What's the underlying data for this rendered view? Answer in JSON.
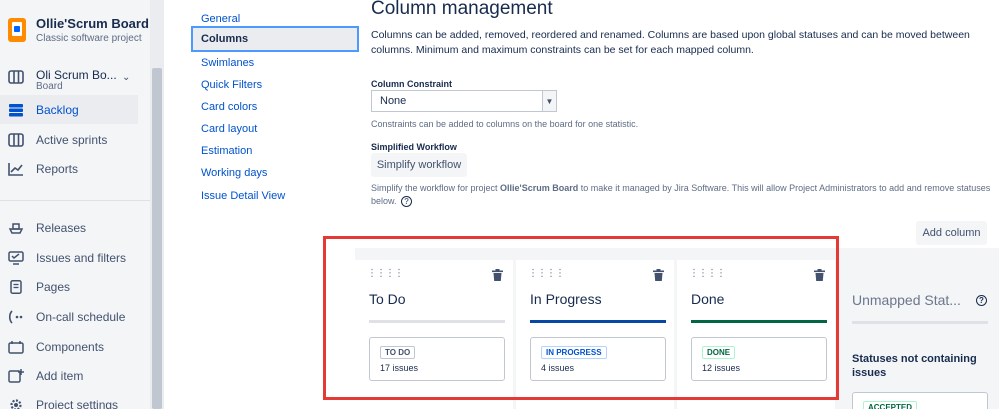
{
  "project": {
    "name": "Ollie'Scrum Board",
    "type": "Classic software project"
  },
  "board": {
    "name": "Oli Scrum Bo...",
    "sub": "Board"
  },
  "nav": {
    "top": [
      {
        "label": "Backlog",
        "icon": "backlog-icon",
        "active": true
      },
      {
        "label": "Active sprints",
        "icon": "board-columns-icon"
      },
      {
        "label": "Reports",
        "icon": "chart-icon"
      }
    ],
    "bottom": [
      {
        "label": "Releases",
        "icon": "ship-icon"
      },
      {
        "label": "Issues and filters",
        "icon": "issues-icon"
      },
      {
        "label": "Pages",
        "icon": "page-icon"
      },
      {
        "label": "On-call schedule",
        "icon": "on-call-icon"
      },
      {
        "label": "Components",
        "icon": "component-icon"
      },
      {
        "label": "Add item",
        "icon": "add-item-icon"
      },
      {
        "label": "Project settings",
        "icon": "gear-icon"
      }
    ]
  },
  "settings_menu": {
    "items": [
      "General",
      "Columns",
      "Swimlanes",
      "Quick Filters",
      "Card colors",
      "Card layout",
      "Estimation",
      "Working days",
      "Issue Detail View"
    ],
    "active": "Columns"
  },
  "main": {
    "title": "Column management",
    "description": "Columns can be added, removed, reordered and renamed. Columns are based upon global statuses and can be moved between columns. Minimum and maximum constraints can be set for each mapped column.",
    "constraint_label": "Column Constraint",
    "constraint_value": "None",
    "constraint_help": "Constraints can be added to columns on the board for one statistic.",
    "workflow_label": "Simplified Workflow",
    "workflow_button": "Simplify workflow",
    "workflow_help_pre": "Simplify the workflow for project ",
    "workflow_help_project": "Ollie'Scrum Board",
    "workflow_help_post": " to make it managed by Jira Software. This will allow Project Administrators to add and remove statuses below.",
    "add_column": "Add column"
  },
  "columns": [
    {
      "title": "To Do",
      "status": "TO DO",
      "count": "17 issues",
      "bar_color": "#dfe1e6",
      "lozenge_bg": "#fff",
      "lozenge_fg": "#42526e",
      "lozenge_border": "#c1c7d0"
    },
    {
      "title": "In Progress",
      "status": "IN PROGRESS",
      "count": "4 issues",
      "bar_color": "#0747a6",
      "lozenge_bg": "#fff",
      "lozenge_fg": "#0052cc",
      "lozenge_border": "#b3d4ff"
    },
    {
      "title": "Done",
      "status": "DONE",
      "count": "12 issues",
      "bar_color": "#006644",
      "lozenge_bg": "#fff",
      "lozenge_fg": "#006644",
      "lozenge_border": "#abf5d1"
    }
  ],
  "unmapped": {
    "title": "Unmapped Stat...",
    "subtitle": "Statuses not containing issues",
    "lozenge": "ACCEPTED"
  },
  "colors": {
    "accent": "#0052cc",
    "highlight": "#e53935"
  }
}
